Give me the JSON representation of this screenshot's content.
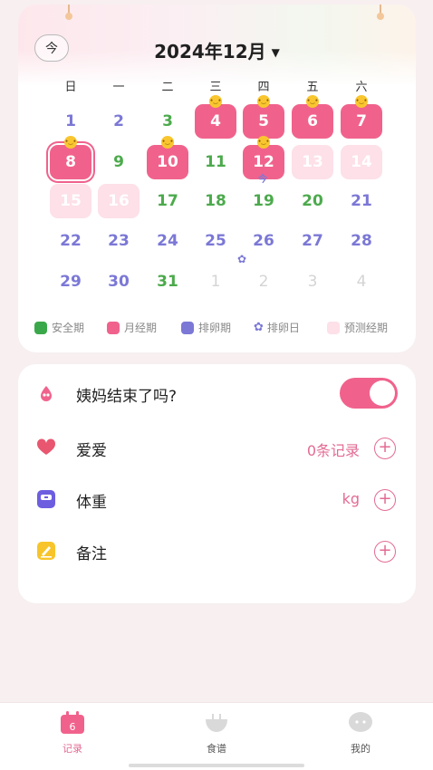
{
  "calendar": {
    "today_button": "今",
    "month_title": "2024年12月",
    "weekdays": [
      "日",
      "一",
      "二",
      "三",
      "四",
      "五",
      "六"
    ],
    "days": [
      {
        "n": "1",
        "type": "ovu"
      },
      {
        "n": "2",
        "type": "ovu"
      },
      {
        "n": "3",
        "type": "safe"
      },
      {
        "n": "4",
        "type": "period",
        "face": true
      },
      {
        "n": "5",
        "type": "period",
        "face": true
      },
      {
        "n": "6",
        "type": "period",
        "face": true
      },
      {
        "n": "7",
        "type": "period",
        "face": true
      },
      {
        "n": "8",
        "type": "period",
        "face": true,
        "today": true
      },
      {
        "n": "9",
        "type": "safe"
      },
      {
        "n": "10",
        "type": "period",
        "face": true
      },
      {
        "n": "11",
        "type": "safe"
      },
      {
        "n": "12",
        "type": "period",
        "face": true,
        "mark": "今"
      },
      {
        "n": "13",
        "type": "pred"
      },
      {
        "n": "14",
        "type": "pred"
      },
      {
        "n": "15",
        "type": "pred"
      },
      {
        "n": "16",
        "type": "pred"
      },
      {
        "n": "17",
        "type": "safe"
      },
      {
        "n": "18",
        "type": "safe"
      },
      {
        "n": "19",
        "type": "safe"
      },
      {
        "n": "20",
        "type": "safe"
      },
      {
        "n": "21",
        "type": "ovu"
      },
      {
        "n": "22",
        "type": "ovu"
      },
      {
        "n": "23",
        "type": "ovu"
      },
      {
        "n": "24",
        "type": "ovu"
      },
      {
        "n": "25",
        "type": "ovu"
      },
      {
        "n": "26",
        "type": "ovu",
        "flower": true
      },
      {
        "n": "27",
        "type": "ovu"
      },
      {
        "n": "28",
        "type": "ovu"
      },
      {
        "n": "29",
        "type": "ovu"
      },
      {
        "n": "30",
        "type": "ovu"
      },
      {
        "n": "31",
        "type": "safe"
      },
      {
        "n": "1",
        "type": "other"
      },
      {
        "n": "2",
        "type": "other"
      },
      {
        "n": "3",
        "type": "other"
      },
      {
        "n": "4",
        "type": "other"
      }
    ],
    "legend": [
      {
        "label": "安全期",
        "color": "#3aa84a",
        "kind": "swatch"
      },
      {
        "label": "月经期",
        "color": "#f0628c",
        "kind": "swatch"
      },
      {
        "label": "排卵期",
        "color": "#7b78d6",
        "kind": "swatch"
      },
      {
        "label": "排卵日",
        "color": "#7b78d6",
        "kind": "flower"
      },
      {
        "label": "预测经期",
        "color": "#fde0e8",
        "kind": "swatch"
      }
    ]
  },
  "records": {
    "period_end": {
      "label": "姨妈结束了吗?",
      "toggle_on": true
    },
    "love": {
      "label": "爱爱",
      "value": "0条记录"
    },
    "weight": {
      "label": "体重",
      "value": "kg"
    },
    "note": {
      "label": "备注",
      "value": ""
    }
  },
  "tabs": [
    {
      "label": "记录",
      "icon": "calendar-icon",
      "active": true,
      "badge": "6"
    },
    {
      "label": "食谱",
      "icon": "bowl-icon",
      "active": false
    },
    {
      "label": "我的",
      "icon": "chat-bubble-icon",
      "active": false
    }
  ],
  "colors": {
    "accent": "#f0628c",
    "safe": "#4caa4c",
    "ovulation": "#7b78d6",
    "predicted": "#fde0e8"
  }
}
